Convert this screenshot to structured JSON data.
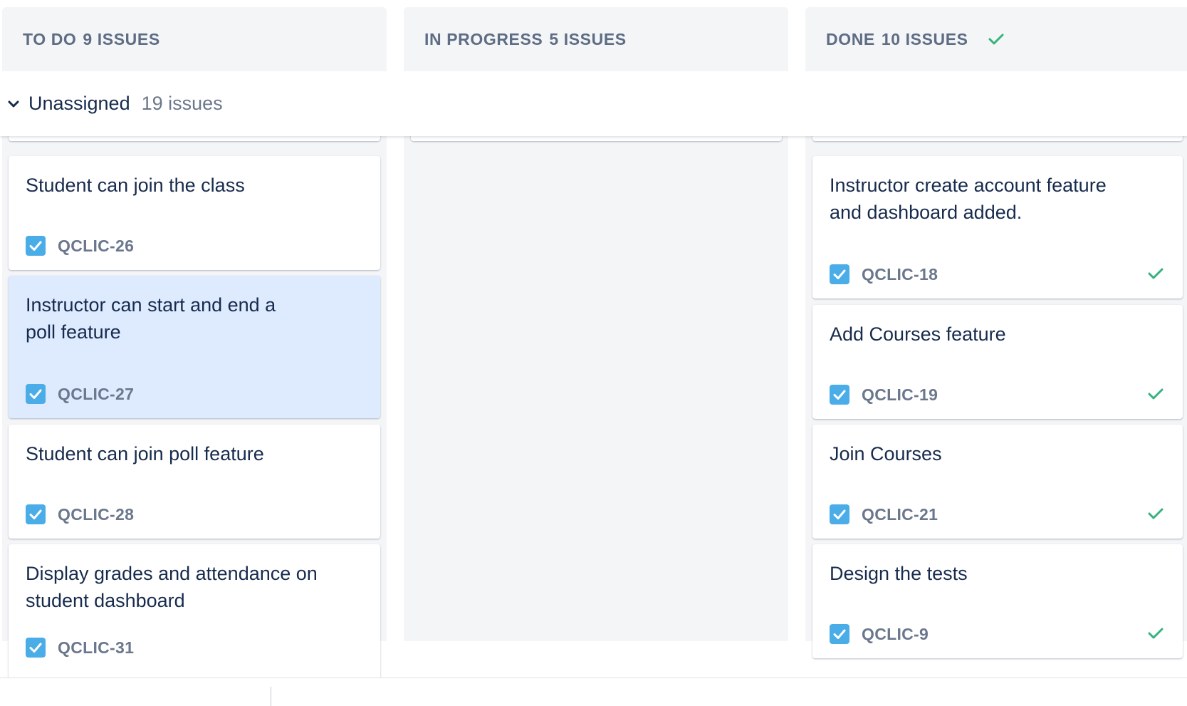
{
  "columns": [
    {
      "name": "TO DO",
      "count": "9 ISSUES"
    },
    {
      "name": "IN PROGRESS",
      "count": "5 ISSUES"
    },
    {
      "name": "DONE",
      "count": "10 ISSUES"
    }
  ],
  "swimlane": {
    "title": "Unassigned",
    "count": "19 issues"
  },
  "todo_cards": [
    {
      "summary": "Student can join the class",
      "key": "QCLIC-26",
      "selected": false
    },
    {
      "summary": "Instructor can start and end a poll feature",
      "key": "QCLIC-27",
      "selected": true
    },
    {
      "summary": "Student can join poll feature",
      "key": "QCLIC-28",
      "selected": false
    },
    {
      "summary": "Display grades and attendance on student dashboard",
      "key": "QCLIC-31",
      "selected": false
    }
  ],
  "done_cards": [
    {
      "summary": "Instructor create account feature and dashboard added.",
      "key": "QCLIC-18"
    },
    {
      "summary": "Add Courses feature",
      "key": "QCLIC-19"
    },
    {
      "summary": "Join Courses",
      "key": "QCLIC-21"
    },
    {
      "summary": "Design the tests",
      "key": "QCLIC-9"
    }
  ],
  "icons": {
    "issue_type": "checkbox-story-icon",
    "done": "checkmark-icon",
    "swimlane_toggle": "chevron-down-icon"
  },
  "colors": {
    "column_bg": "#f4f5f7",
    "selected_card": "#deebff",
    "done_green": "#36b37e",
    "task_blue": "#4bade8"
  }
}
